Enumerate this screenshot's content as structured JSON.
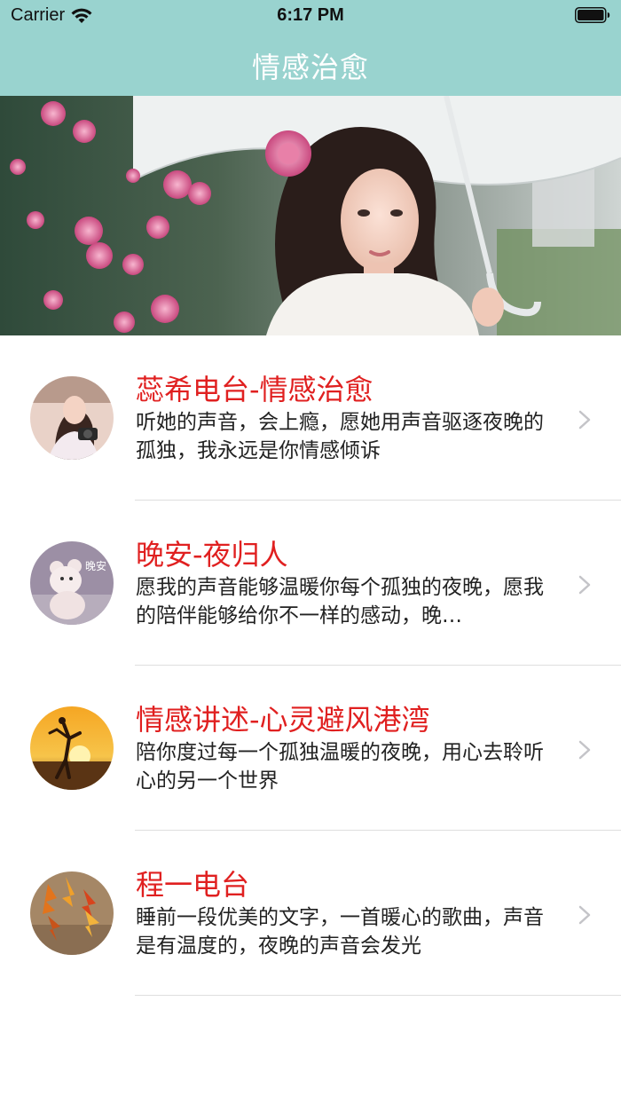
{
  "status_bar": {
    "carrier": "Carrier",
    "time": "6:17 PM",
    "icons": [
      "wifi-icon",
      "battery-icon"
    ]
  },
  "nav": {
    "title": "情感治愈"
  },
  "banner": {
    "image": "banner-image-woman-umbrella-roses"
  },
  "items": [
    {
      "title": "蕊希电台-情感治愈",
      "description": "听她的声音，会上瘾，愿她用声音驱逐夜晚的孤独，我永远是你情感倾诉",
      "avatar": "avatar-girl-camera"
    },
    {
      "title": "晚安-夜归人",
      "description": "愿我的声音能够温暖你每个孤独的夜晚，愿我的陪伴能够给你不一样的感动，晚…",
      "avatar": "avatar-teddy-bear",
      "avatar_text": "晚安"
    },
    {
      "title": "情感讲述-心灵避风港湾",
      "description": "陪你度过每一个孤独温暖的夜晚，用心去聆听心的另一个世界",
      "avatar": "avatar-sunset-couple"
    },
    {
      "title": "程一电台",
      "description": "睡前一段优美的文字，一首暖心的歌曲，声音是有温度的，夜晚的声音会发光",
      "avatar": "avatar-autumn-leaves"
    }
  ],
  "colors": {
    "nav_background": "#99d3cf",
    "title_red": "#e02020",
    "divider": "#dedede"
  }
}
